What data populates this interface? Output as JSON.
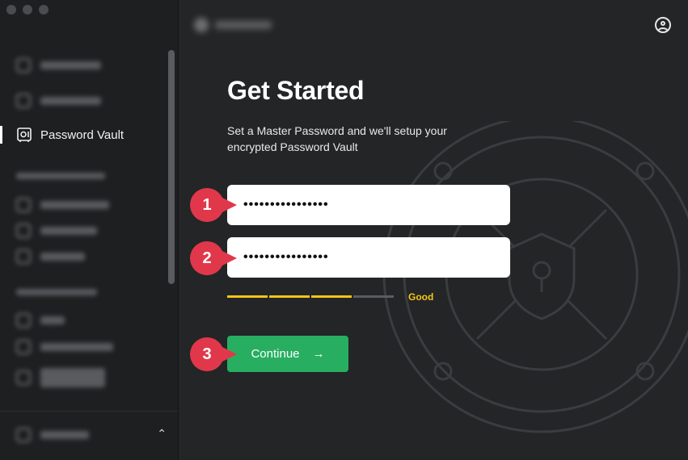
{
  "sidebar": {
    "active_item": "Password Vault"
  },
  "main": {
    "title": "Get Started",
    "subtitle": "Set a Master Password and we'll setup your encrypted Password Vault",
    "password_value": "••••••••••••••••",
    "confirm_value": "••••••••••••••••",
    "strength": {
      "label": "Good",
      "level": 0.75,
      "segments": 4,
      "filled_color": "#f5c518",
      "empty_color": "#5a5c60"
    },
    "continue_label": "Continue",
    "continue_icon": "→"
  },
  "annotations": [
    "1",
    "2",
    "3"
  ],
  "colors": {
    "accent_green": "#27ae60",
    "badge_red": "#e0384a",
    "background": "#232527"
  }
}
